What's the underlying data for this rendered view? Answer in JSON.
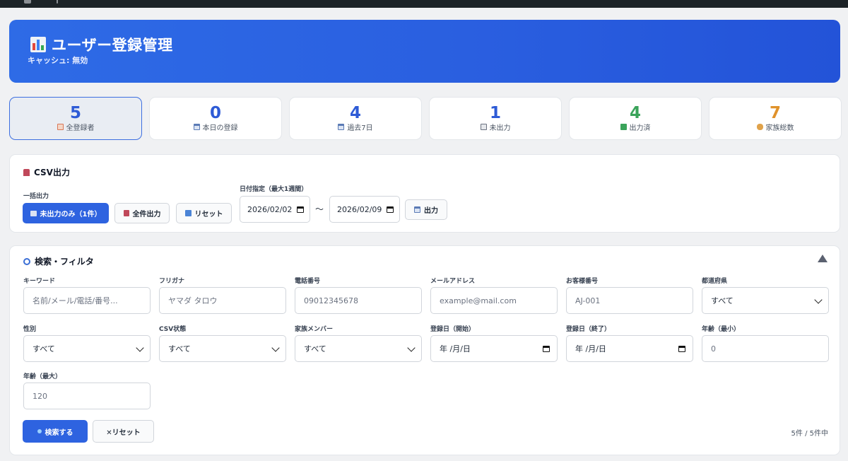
{
  "header": {
    "title": "ユーザー登録管理",
    "cache_status": "キャッシュ: 無効"
  },
  "stats": [
    {
      "value": "5",
      "label": "全登録者",
      "color": "#2e5bd6",
      "icon": "clipboard-icon"
    },
    {
      "value": "0",
      "label": "本日の登録",
      "color": "#2e5bd6",
      "icon": "calendar-icon"
    },
    {
      "value": "4",
      "label": "過去7日",
      "color": "#2e5bd6",
      "icon": "calendar-icon"
    },
    {
      "value": "1",
      "label": "未出力",
      "color": "#2e5bd6",
      "icon": "inbox-icon"
    },
    {
      "value": "4",
      "label": "出力済",
      "color": "#3aa35a",
      "icon": "check-icon"
    },
    {
      "value": "7",
      "label": "家族総数",
      "color": "#e0922b",
      "icon": "family-icon"
    }
  ],
  "csv": {
    "title": "CSV出力",
    "bulk_label": "一括出力",
    "unexported_only": "未出力のみ（1件）",
    "export_all": "全件出力",
    "reset": "リセット",
    "date_label": "日付指定（最大1週間）",
    "date_from": "2026/02/02",
    "tilde": "〜",
    "date_to": "2026/02/09",
    "export": "出力"
  },
  "filter": {
    "title": "検索・フィルタ",
    "keyword": {
      "label": "キーワード",
      "placeholder": "名前/メール/電話/番号..."
    },
    "furigana": {
      "label": "フリガナ",
      "placeholder": "ヤマダ タロウ"
    },
    "phone": {
      "label": "電話番号",
      "placeholder": "09012345678"
    },
    "email": {
      "label": "メールアドレス",
      "placeholder": "example@mail.com"
    },
    "customer_no": {
      "label": "お客様番号",
      "placeholder": "AJ-001"
    },
    "prefecture": {
      "label": "都道府県",
      "value": "すべて"
    },
    "gender": {
      "label": "性別",
      "value": "すべて"
    },
    "csv_status": {
      "label": "CSV状態",
      "value": "すべて"
    },
    "family": {
      "label": "家族メンバー",
      "value": "すべて"
    },
    "reg_start": {
      "label": "登録日（開始）",
      "value": "年 /月/日"
    },
    "reg_end": {
      "label": "登録日（終了）",
      "value": "年 /月/日"
    },
    "age_min": {
      "label": "年齢（最小）",
      "placeholder": "0"
    },
    "age_max": {
      "label": "年齢（最大）",
      "placeholder": "120"
    },
    "search_button": "検索する",
    "reset_button": "✕リセット",
    "result_count": "5件 / 5件中"
  },
  "colors": {
    "accent": "#2e63e0",
    "header_gradient_start": "#2e6be6",
    "header_gradient_end": "#2353d8"
  }
}
